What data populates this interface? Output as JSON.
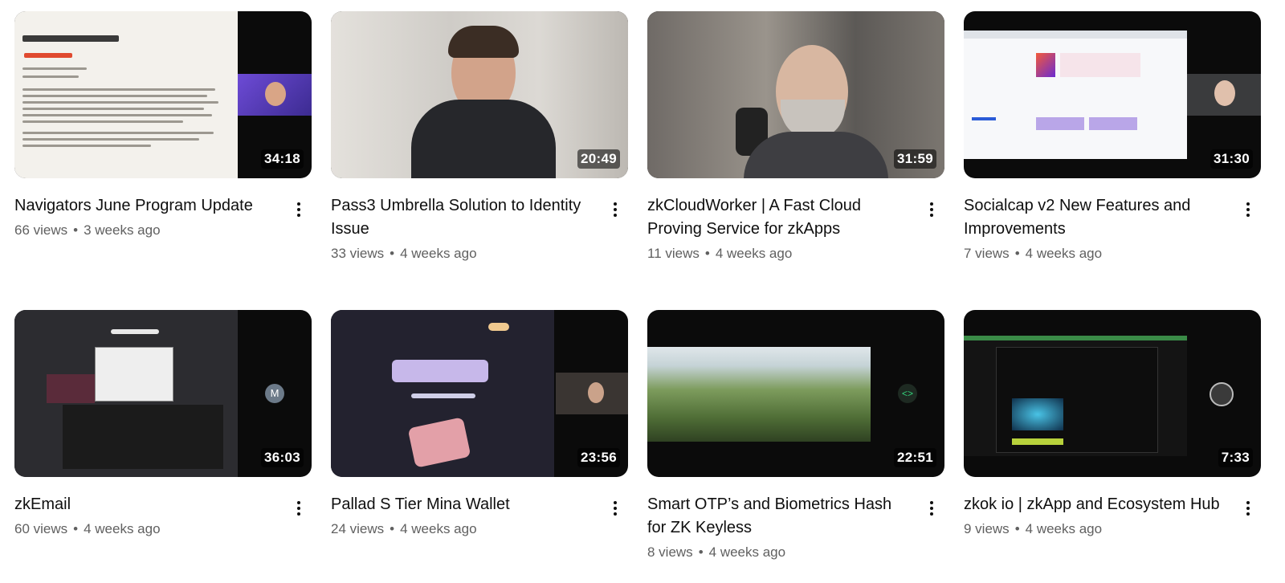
{
  "videos": [
    {
      "title": "Navigators June Program Update",
      "views": "66 views",
      "age": "3 weeks ago",
      "duration": "34:18",
      "more_icon": "more-vert-icon"
    },
    {
      "title": "Pass3 Umbrella Solution to Identity Issue",
      "views": "33 views",
      "age": "4 weeks ago",
      "duration": "20:49",
      "more_icon": "more-vert-icon"
    },
    {
      "title": "zkCloudWorker | A Fast Cloud Proving Service for zkApps",
      "views": "11 views",
      "age": "4 weeks ago",
      "duration": "31:59",
      "more_icon": "more-vert-icon"
    },
    {
      "title": "Socialcap v2 New Features and Improvements",
      "views": "7 views",
      "age": "4 weeks ago",
      "duration": "31:30",
      "more_icon": "more-vert-icon"
    },
    {
      "title": "zkEmail",
      "views": "60 views",
      "age": "4 weeks ago",
      "duration": "36:03",
      "more_icon": "more-vert-icon"
    },
    {
      "title": "Pallad S Tier Mina Wallet",
      "views": "24 views",
      "age": "4 weeks ago",
      "duration": "23:56",
      "more_icon": "more-vert-icon"
    },
    {
      "title": "Smart OTP’s and Biometrics Hash for ZK Keyless",
      "views": "8 views",
      "age": "4 weeks ago",
      "duration": "22:51",
      "more_icon": "more-vert-icon"
    },
    {
      "title": "zkok io | zkApp and Ecosystem Hub",
      "views": "9 views",
      "age": "4 weeks ago",
      "duration": "7:33",
      "more_icon": "more-vert-icon"
    }
  ],
  "separator": "•",
  "thumbnail_text": {
    "avatar_letter": "M"
  },
  "colors": {
    "text_primary": "#0f0f0f",
    "text_secondary": "#606060",
    "background": "#ffffff",
    "duration_badge": "#000000"
  }
}
